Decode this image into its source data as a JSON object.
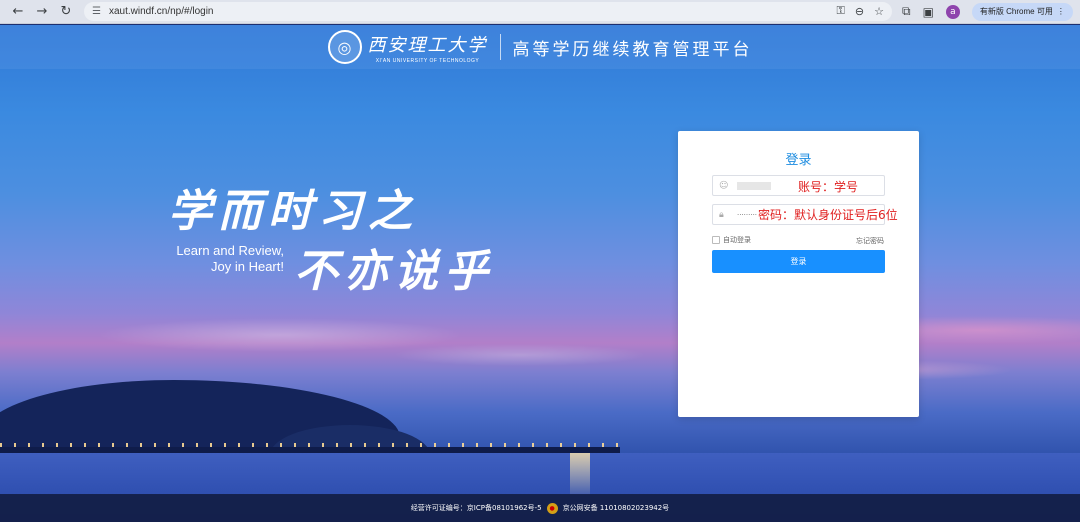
{
  "browser": {
    "url": "xaut.windf.cn/np/#/login",
    "update_label": "有新版 Chrome 可用",
    "profile_initial": "a",
    "icons": [
      "back-icon",
      "forward-icon",
      "reload-icon",
      "tune-icon",
      "key-icon",
      "zoom-icon",
      "star-icon",
      "extensions-icon",
      "sidepanel-icon",
      "menu-icon"
    ]
  },
  "header": {
    "logo_cn": "西安理工大学",
    "logo_en": "XI'AN UNIVERSITY OF TECHNOLOGY",
    "platform_title": "高等学历继续教育管理平台"
  },
  "slogan": {
    "line1": "学而时习之",
    "line2": "不亦说乎",
    "en_line1": "Learn and Review,",
    "en_line2": "Joy in Heart!"
  },
  "login": {
    "title": "登录",
    "password_mask": "·········",
    "annotation_user": "账号：学号",
    "annotation_pass": "密码：默认身份证号后6位",
    "remember_label": "自动登录",
    "forgot_label": "忘记密码",
    "button_label": "登录"
  },
  "footer": {
    "icp": "经营许可证编号：京ICP备08101962号-5",
    "police": "京公网安备 11010802023942号"
  },
  "colors": {
    "accent": "#1890ff",
    "title_blue": "#1d8ce0",
    "annotation_red": "#e02020"
  }
}
